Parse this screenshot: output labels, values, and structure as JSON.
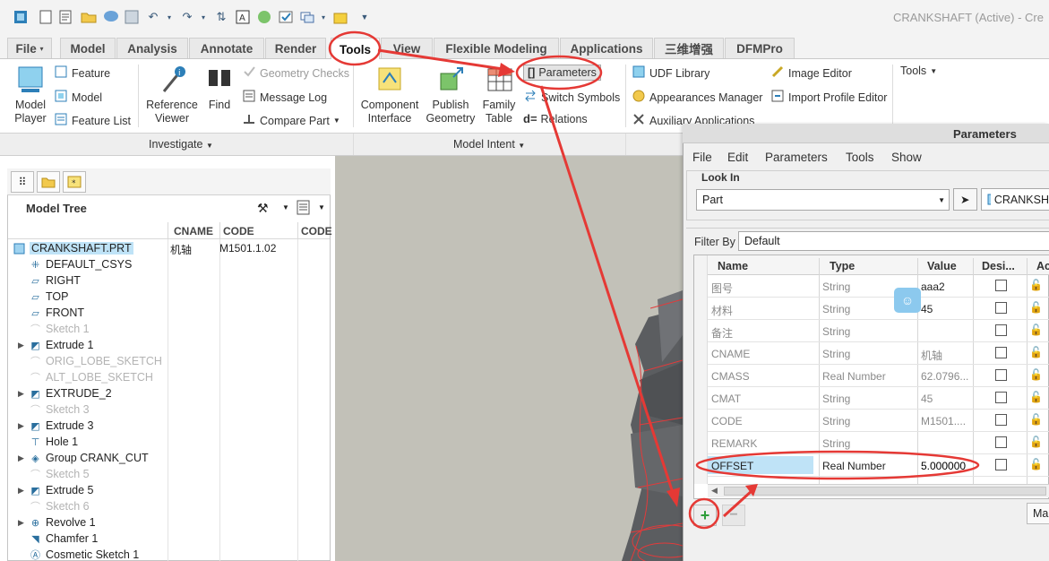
{
  "window": {
    "title": "CRANKSHAFT (Active) - Cre"
  },
  "tabs": [
    "File",
    "Model",
    "Analysis",
    "Annotate",
    "Render",
    "Tools",
    "View",
    "Flexible Modeling",
    "Applications",
    "三维增强",
    "DFMPro"
  ],
  "active_tab": "Tools",
  "ribbon": {
    "model_player": "Model\nPlayer",
    "feature": "Feature",
    "model": "Model",
    "feature_list": "Feature List",
    "reference_viewer": "Reference\nViewer",
    "find": "Find",
    "geometry_checks": "Geometry Checks",
    "message_log": "Message Log",
    "compare_part": "Compare Part",
    "component_interface": "Component\nInterface",
    "publish_geometry": "Publish\nGeometry",
    "family_table": "Family\nTable",
    "parameters": "Parameters",
    "switch_symbols": "Switch Symbols",
    "relations": "Relations",
    "udf_library": "UDF Library",
    "appearances_manager": "Appearances Manager",
    "auxiliary_applications": "Auxiliary Applications",
    "image_editor": "Image Editor",
    "import_profile_editor": "Import Profile Editor",
    "tools_menu": "Tools",
    "group_investigate": "Investigate",
    "group_model_intent": "Model Intent"
  },
  "model_tree": {
    "title": "Model Tree",
    "columns": [
      "CNAME",
      "CODE",
      "CODE"
    ],
    "root": {
      "label": "CRANKSHAFT.PRT",
      "cname": "机轴",
      "code": "M1501.1.02"
    },
    "items": [
      {
        "label": "DEFAULT_CSYS",
        "dim": false,
        "expand": false,
        "icon": "csys-icon"
      },
      {
        "label": "RIGHT",
        "dim": false,
        "expand": false,
        "icon": "datum-plane-icon"
      },
      {
        "label": "TOP",
        "dim": false,
        "expand": false,
        "icon": "datum-plane-icon"
      },
      {
        "label": "FRONT",
        "dim": false,
        "expand": false,
        "icon": "datum-plane-icon"
      },
      {
        "label": "Sketch 1",
        "dim": true,
        "expand": false,
        "icon": "sketch-icon"
      },
      {
        "label": "Extrude 1",
        "dim": false,
        "expand": true,
        "icon": "extrude-icon"
      },
      {
        "label": "ORIG_LOBE_SKETCH",
        "dim": true,
        "expand": false,
        "icon": "sketch-icon"
      },
      {
        "label": "ALT_LOBE_SKETCH",
        "dim": true,
        "expand": false,
        "icon": "sketch-icon"
      },
      {
        "label": "EXTRUDE_2",
        "dim": false,
        "expand": true,
        "icon": "extrude-icon"
      },
      {
        "label": "Sketch 3",
        "dim": true,
        "expand": false,
        "icon": "sketch-icon"
      },
      {
        "label": "Extrude 3",
        "dim": false,
        "expand": true,
        "icon": "extrude-icon"
      },
      {
        "label": "Hole 1",
        "dim": false,
        "expand": false,
        "icon": "hole-icon"
      },
      {
        "label": "Group CRANK_CUT",
        "dim": false,
        "expand": true,
        "icon": "group-icon"
      },
      {
        "label": "Sketch 5",
        "dim": true,
        "expand": false,
        "icon": "sketch-icon"
      },
      {
        "label": "Extrude 5",
        "dim": false,
        "expand": true,
        "icon": "extrude-icon"
      },
      {
        "label": "Sketch 6",
        "dim": true,
        "expand": false,
        "icon": "sketch-icon"
      },
      {
        "label": "Revolve 1",
        "dim": false,
        "expand": true,
        "icon": "revolve-icon"
      },
      {
        "label": "Chamfer 1",
        "dim": false,
        "expand": false,
        "icon": "chamfer-icon"
      },
      {
        "label": "Cosmetic Sketch 1",
        "dim": false,
        "expand": false,
        "icon": "cosmetic-sketch-icon"
      }
    ]
  },
  "parameters_dialog": {
    "title": "Parameters",
    "menus": [
      "File",
      "Edit",
      "Parameters",
      "Tools",
      "Show"
    ],
    "look_in_label": "Look In",
    "look_in_value": "Part",
    "object_value": "CRANKSH",
    "filter_by_label": "Filter By",
    "filter_by_value": "Default",
    "columns": [
      "Name",
      "Type",
      "Value",
      "Desi...",
      "Ac"
    ],
    "rows": [
      {
        "name": "图号",
        "type": "String",
        "value": "aaa2",
        "gray": true
      },
      {
        "name": "材料",
        "type": "String",
        "value": "45",
        "gray": true
      },
      {
        "name": "备注",
        "type": "String",
        "value": "",
        "gray": true
      },
      {
        "name": "CNAME",
        "type": "String",
        "value": "机轴",
        "gray": true
      },
      {
        "name": "CMASS",
        "type": "Real Number",
        "value": "62.0796...",
        "gray": true
      },
      {
        "name": "CMAT",
        "type": "String",
        "value": "45",
        "gray": true
      },
      {
        "name": "CODE",
        "type": "String",
        "value": "M1501....",
        "gray": true
      },
      {
        "name": "REMARK",
        "type": "String",
        "value": "",
        "gray": true
      },
      {
        "name": "OFFSET",
        "type": "Real Number",
        "value": "5.000000",
        "gray": false
      }
    ],
    "add_button": "+",
    "remove_button": "−",
    "main_button": "Mai"
  },
  "colors": {
    "accent_red": "#e53935",
    "highlight_blue": "#bfe3f7",
    "add_green": "#2e9e3a"
  }
}
